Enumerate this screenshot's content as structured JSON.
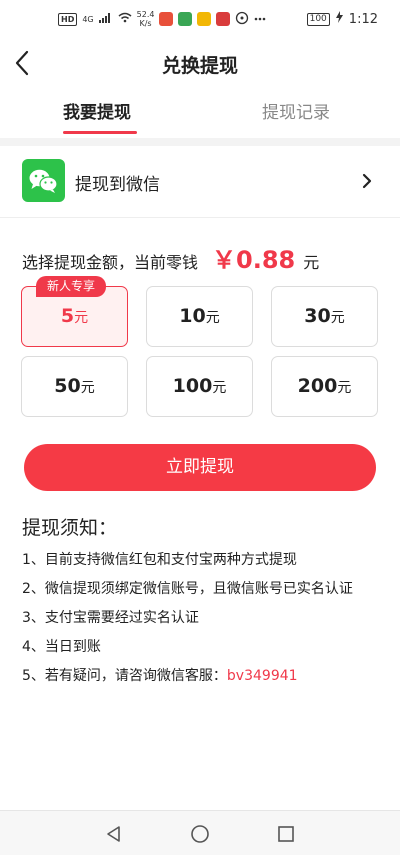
{
  "status_bar": {
    "left_labels": [
      "HD",
      "4G"
    ],
    "speed": "52.4",
    "speed_unit": "K/s",
    "battery": "100",
    "time": "1:12"
  },
  "header": {
    "title": "兑换提现"
  },
  "tabs": [
    {
      "label": "我要提现",
      "active": true
    },
    {
      "label": "提现记录",
      "active": false
    }
  ],
  "wechat": {
    "label": "提现到微信",
    "icon": "wechat-icon"
  },
  "amount": {
    "prompt": "选择提现金额，当前零钱",
    "value": "￥0.88",
    "unit": "元"
  },
  "options": [
    {
      "num": "5",
      "unit": "元",
      "badge": "新人专享",
      "selected": true
    },
    {
      "num": "10",
      "unit": "元",
      "selected": false
    },
    {
      "num": "30",
      "unit": "元",
      "selected": false
    },
    {
      "num": "50",
      "unit": "元",
      "selected": false
    },
    {
      "num": "100",
      "unit": "元",
      "selected": false
    },
    {
      "num": "200",
      "unit": "元",
      "selected": false
    }
  ],
  "withdraw_button": "立即提现",
  "notes": {
    "title": "提现须知：",
    "items": [
      "1、目前支持微信红包和支付宝两种方式提现",
      "2、微信提现须绑定微信账号，且微信账号已实名认证",
      "3、支付宝需要经过实名认证",
      "4、当日到账",
      "5、若有疑问，请咨询微信客服："
    ],
    "service_id": "bv349941"
  },
  "colors": {
    "accent": "#f0394a",
    "wechat_green": "#2dc24a"
  }
}
